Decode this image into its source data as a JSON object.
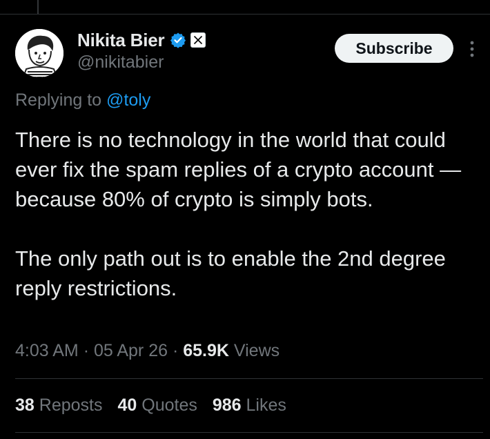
{
  "author": {
    "display_name": "Nikita Bier",
    "handle": "@nikitabier",
    "verified": true
  },
  "subscribe_label": "Subscribe",
  "reply_context": {
    "prefix": "Replying to",
    "handle": "@toly"
  },
  "tweet": {
    "paragraphs": [
      "There is no technology in the world that could ever fix the spam replies of a crypto account — because 80% of crypto is simply bots.",
      "The only path out is to enable the 2nd degree reply restrictions."
    ]
  },
  "meta": {
    "time": "4:03 AM",
    "separator": "·",
    "date": "05 Apr 26",
    "views_count": "65.9K",
    "views_label": "Views"
  },
  "stats": {
    "reposts_count": "38",
    "reposts_label": "Reposts",
    "quotes_count": "40",
    "quotes_label": "Quotes",
    "likes_count": "986",
    "likes_label": "Likes"
  },
  "colors": {
    "background": "#000000",
    "text": "#e7e9ea",
    "muted": "#71767b",
    "link": "#1d9bf0",
    "divider": "#2f3336"
  }
}
